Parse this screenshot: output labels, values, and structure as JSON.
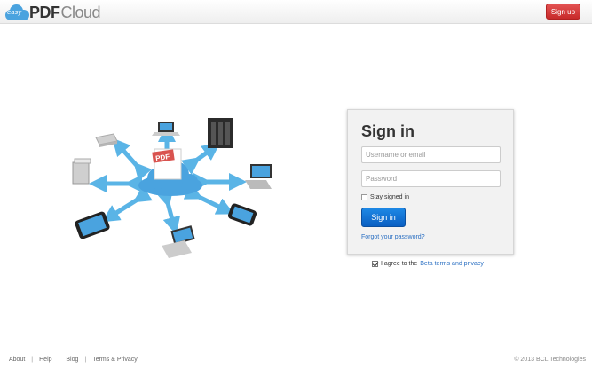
{
  "header": {
    "logo_easy": "easy",
    "logo_pdf": "PDF",
    "logo_cloud": "Cloud",
    "signup_label": "Sign up"
  },
  "hero": {
    "pdf_badge": "PDF"
  },
  "signin": {
    "title": "Sign in",
    "username_placeholder": "Username or email",
    "password_placeholder": "Password",
    "stay_label": "Stay signed in",
    "button_label": "Sign in",
    "forgot_label": "Forgot your password?"
  },
  "agree": {
    "text": "I agree to the",
    "link": "Beta terms and privacy"
  },
  "footer": {
    "links": [
      "About",
      "Help",
      "Blog",
      "Terms & Privacy"
    ],
    "separator": "|",
    "copyright": "© 2013 BCL Technologies"
  },
  "colors": {
    "accent_blue": "#1e88e5",
    "signup_red": "#d93a3a",
    "cloud_blue": "#4aa3df",
    "arrow_blue": "#5ab4e6"
  }
}
